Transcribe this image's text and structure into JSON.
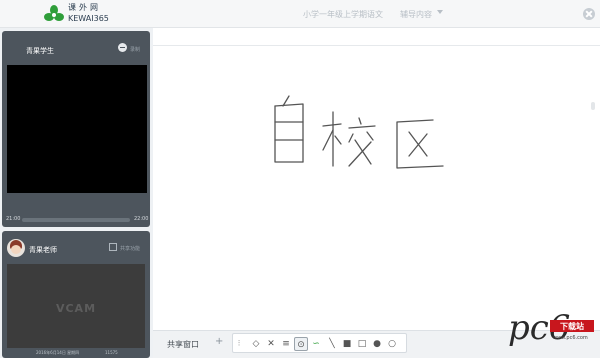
{
  "app": {
    "brand_cn": "课外网",
    "brand_en": "KEWAI365",
    "course_title": "小学一年级上学期语文",
    "assist_menu": "辅导内容"
  },
  "student": {
    "name": "青果学生",
    "record_label": "录制",
    "time_start": "21:00",
    "time_end": "22:00",
    "progress_fraction": 0.0
  },
  "teacher": {
    "name": "青果老师",
    "share_label": "共享功能",
    "share_checked": false,
    "video_text": "VCAM",
    "footer_date": "2016年6月14日 星期四",
    "footer_code": "11575"
  },
  "whiteboard": {
    "handwriting": "自校区"
  },
  "bottom": {
    "share_window": "共享窗口",
    "add_label": "+",
    "tools": [
      {
        "icon": "handle-icon",
        "glyph": "⁝"
      },
      {
        "icon": "eraser-icon",
        "glyph": "◇"
      },
      {
        "icon": "clear-icon",
        "glyph": "✕"
      },
      {
        "icon": "line-width-icon",
        "glyph": "≡"
      },
      {
        "icon": "pen-icon",
        "glyph": "⊙",
        "active": true
      },
      {
        "icon": "curve-icon",
        "glyph": "∽",
        "color": "#2f9e3a"
      },
      {
        "icon": "line-icon",
        "glyph": "╲"
      },
      {
        "icon": "filled-rect-icon",
        "glyph": "■"
      },
      {
        "icon": "rect-icon",
        "glyph": "□"
      },
      {
        "icon": "filled-circle-icon",
        "glyph": "●"
      },
      {
        "icon": "circle-icon",
        "glyph": "○"
      }
    ]
  },
  "watermark": {
    "letters": "pc6",
    "box_text": "下载站",
    "url": "www.pc6.com"
  },
  "colors": {
    "panel": "#4d555d",
    "brand_green": "#2f9e3a",
    "watermark_red": "#c8161d"
  }
}
